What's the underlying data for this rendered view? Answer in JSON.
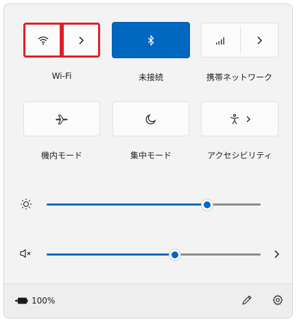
{
  "tiles": {
    "wifi": {
      "label": "Wi-Fi",
      "icon": "wifi-icon"
    },
    "bluetooth": {
      "label": "未接続",
      "icon": "bluetooth-icon"
    },
    "cellular": {
      "label": "携帯ネットワーク",
      "icon": "cellular-signal-icon"
    },
    "airplane": {
      "label": "機内モード",
      "icon": "airplane-icon"
    },
    "focus": {
      "label": "集中モード",
      "icon": "moon-icon"
    },
    "accessibility": {
      "label": "アクセシビリティ",
      "icon": "accessibility-icon"
    }
  },
  "sliders": {
    "brightness": {
      "value": 0.75,
      "icon": "sun-icon"
    },
    "volume": {
      "value": 0.6,
      "icon": "speaker-muted-icon"
    }
  },
  "footer": {
    "battery_text": "100%",
    "battery_icon": "battery-icon",
    "edit_icon": "pencil-icon",
    "settings_icon": "gear-icon"
  },
  "colors": {
    "accent": "#0067c0",
    "highlight": "#e11d2a"
  }
}
